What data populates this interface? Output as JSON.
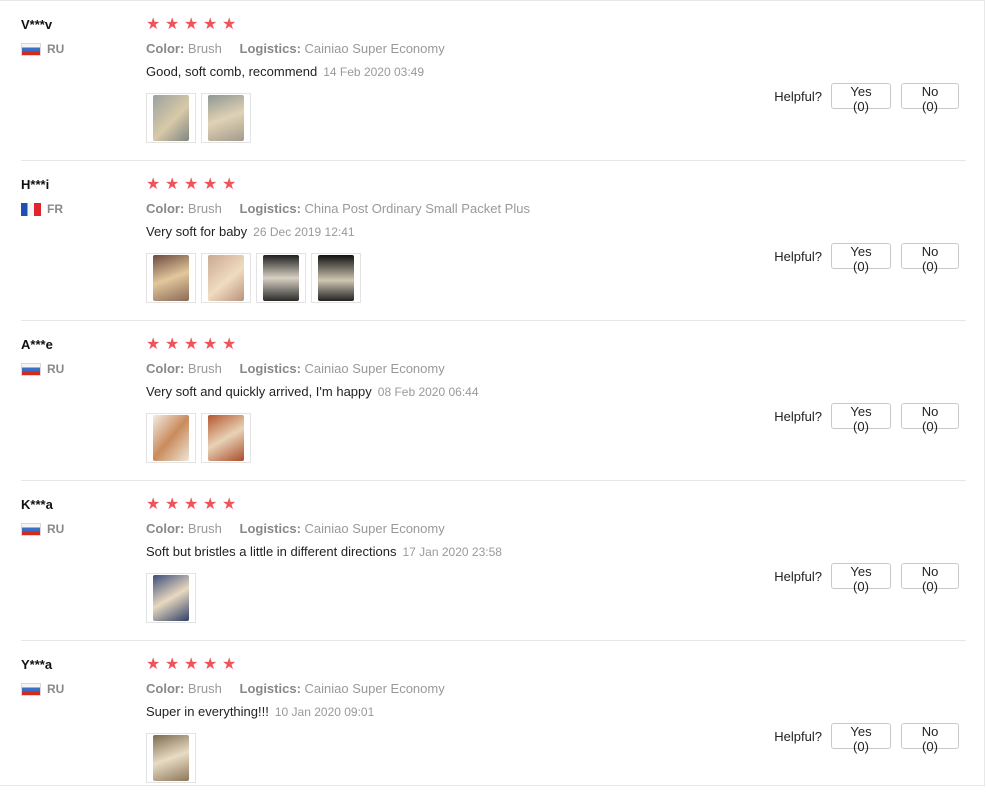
{
  "labels": {
    "color": "Color:",
    "logistics": "Logistics:",
    "helpful": "Helpful?"
  },
  "colors": {
    "star": "#f0535c"
  },
  "reviews": [
    {
      "user": "V***v",
      "country": "RU",
      "flag": "ru",
      "stars": 5,
      "color_value": "Brush",
      "logistics_value": "Cainiao Super Economy",
      "text": "Good, soft comb, recommend",
      "date": "14 Feb 2020 03:49",
      "photos": 2,
      "yes": "Yes (0)",
      "no": "No (0)"
    },
    {
      "user": "H***i",
      "country": "FR",
      "flag": "fr",
      "stars": 5,
      "color_value": "Brush",
      "logistics_value": "China Post Ordinary Small Packet Plus",
      "text": "Very soft for baby",
      "date": "26 Dec 2019 12:41",
      "photos": 4,
      "yes": "Yes (0)",
      "no": "No (0)"
    },
    {
      "user": "A***e",
      "country": "RU",
      "flag": "ru",
      "stars": 5,
      "color_value": "Brush",
      "logistics_value": "Cainiao Super Economy",
      "text": "Very soft and quickly arrived, I'm happy",
      "date": "08 Feb 2020 06:44",
      "photos": 2,
      "yes": "Yes (0)",
      "no": "No (0)"
    },
    {
      "user": "K***a",
      "country": "RU",
      "flag": "ru",
      "stars": 5,
      "color_value": "Brush",
      "logistics_value": "Cainiao Super Economy",
      "text": "Soft but bristles a little in different directions",
      "date": "17 Jan 2020 23:58",
      "photos": 1,
      "yes": "Yes (0)",
      "no": "No (0)"
    },
    {
      "user": "Y***a",
      "country": "RU",
      "flag": "ru",
      "stars": 5,
      "color_value": "Brush",
      "logistics_value": "Cainiao Super Economy",
      "text": "Super in everything!!!",
      "date": "10 Jan 2020 09:01",
      "photos": 1,
      "yes": "Yes (0)",
      "no": "No (0)"
    }
  ]
}
